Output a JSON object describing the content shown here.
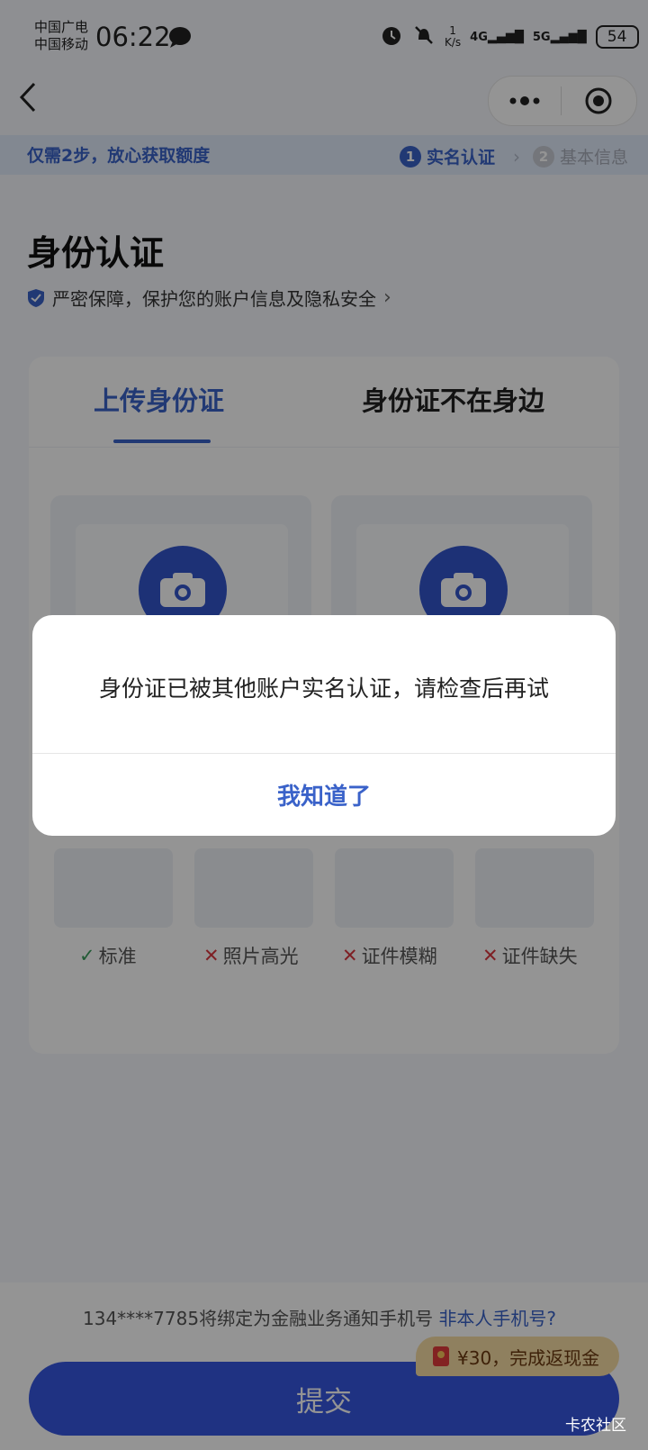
{
  "status_bar": {
    "carrier_1": "中国广电",
    "carrier_2": "中国移动",
    "time": "06:22",
    "net_speed_top": "1",
    "net_speed_bottom": "K/s",
    "net_4g": "4G",
    "net_5g": "5G",
    "battery": "54"
  },
  "nav": {
    "menu_icon": "more-dots-icon",
    "close_icon": "target-icon"
  },
  "steps_banner": {
    "text": "仅需2步，放心获取额度",
    "step1_num": "1",
    "step1_label": "实名认证",
    "step2_num": "2",
    "step2_label": "基本信息"
  },
  "page": {
    "title": "身份认证",
    "security_text": "严密保障，保护您的账户信息及隐私安全"
  },
  "tabs": [
    {
      "label": "上传身份证",
      "active": true
    },
    {
      "label": "身份证不在身边",
      "active": false
    }
  ],
  "samples": [
    {
      "label": "标准",
      "ok": true
    },
    {
      "label": "照片高光",
      "ok": false
    },
    {
      "label": "证件模糊",
      "ok": false
    },
    {
      "label": "证件缺失",
      "ok": false
    }
  ],
  "bottom": {
    "phone_text": "134****7785将绑定为金融业务通知手机号",
    "not_me_link": "非本人手机号?",
    "promo": "¥30，完成返现金",
    "submit": "提交"
  },
  "dialog": {
    "message": "身份证已被其他账户实名认证，请检查后再试",
    "confirm": "我知道了"
  },
  "watermark": "卡农社区",
  "colors": {
    "accent": "#3a62c9",
    "button": "#3656e0",
    "promo": "#f7dca4"
  }
}
